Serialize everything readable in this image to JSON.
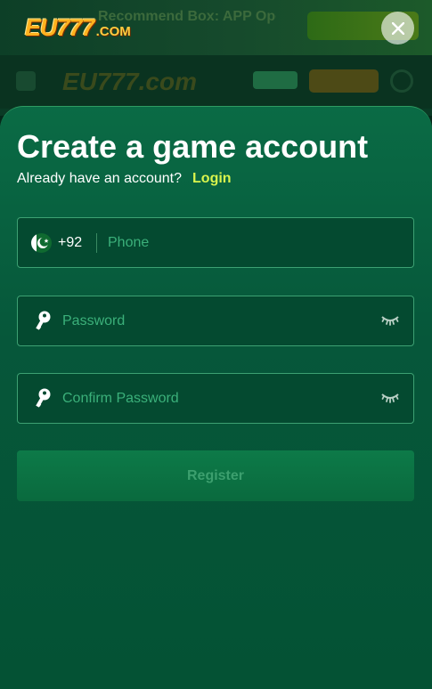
{
  "background": {
    "banner_text": "Recommend Box: APP Open Unique Wheel"
  },
  "header": {
    "logo_main": "EU777",
    "logo_suffix": ".COM"
  },
  "form": {
    "title": "Create a game account",
    "already_text": "Already have an account?",
    "login_link": "Login",
    "phone": {
      "country_code": "+92",
      "placeholder": "Phone",
      "flag": "pakistan-flag-icon"
    },
    "password": {
      "placeholder": "Password",
      "icon": "key-icon",
      "toggle_icon": "eye-closed-icon"
    },
    "confirm_password": {
      "placeholder": "Confirm Password",
      "icon": "key-icon",
      "toggle_icon": "eye-closed-icon"
    },
    "register_label": "Register"
  },
  "colors": {
    "sheet": "#06573a",
    "accent_link": "#d9f44d",
    "field_border": "#3da173",
    "placeholder": "#3bb07a"
  }
}
